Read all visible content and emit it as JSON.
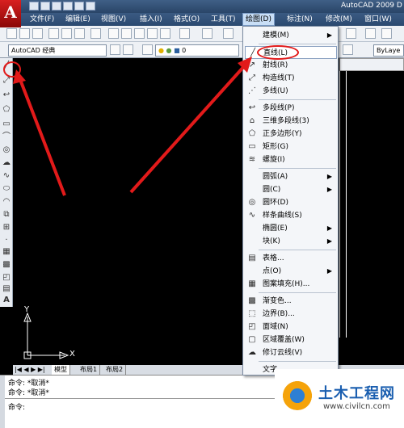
{
  "app": {
    "title": "AutoCAD 2009 D",
    "logo_letter": "A"
  },
  "menubar": {
    "items": [
      "文件(F)",
      "编辑(E)",
      "视图(V)",
      "插入(I)",
      "格式(O)",
      "工具(T)",
      "绘图(D)",
      "标注(N)",
      "修改(M)",
      "窗口(W)"
    ],
    "active_index": 6
  },
  "toolbar": {
    "workspace": "AutoCAD 经典",
    "layer_value": "0",
    "linetype_value": "ByLaye"
  },
  "draw_menu": {
    "items": [
      {
        "label": "建模(M)",
        "icon": "",
        "submenu": true
      },
      {
        "label": "直线(L)",
        "icon": "line-icon",
        "submenu": false,
        "highlighted": true
      },
      {
        "label": "射线(R)",
        "icon": "ray-icon",
        "submenu": false
      },
      {
        "label": "构造线(T)",
        "icon": "xline-icon",
        "submenu": false
      },
      {
        "label": "多线(U)",
        "icon": "mline-icon",
        "submenu": false
      },
      {
        "label": "多段线(P)",
        "icon": "pline-icon",
        "submenu": false
      },
      {
        "label": "三维多段线(3)",
        "icon": "3dpoly-icon",
        "submenu": false
      },
      {
        "label": "正多边形(Y)",
        "icon": "polygon-icon",
        "submenu": false
      },
      {
        "label": "矩形(G)",
        "icon": "rectangle-icon",
        "submenu": false
      },
      {
        "label": "螺旋(I)",
        "icon": "helix-icon",
        "submenu": false
      },
      {
        "label": "圆弧(A)",
        "icon": "",
        "submenu": true
      },
      {
        "label": "圆(C)",
        "icon": "",
        "submenu": true
      },
      {
        "label": "圆环(D)",
        "icon": "donut-icon",
        "submenu": false
      },
      {
        "label": "样条曲线(S)",
        "icon": "spline-icon",
        "submenu": false
      },
      {
        "label": "椭圆(E)",
        "icon": "",
        "submenu": true
      },
      {
        "label": "块(K)",
        "icon": "",
        "submenu": true
      },
      {
        "label": "表格...",
        "icon": "table-icon",
        "submenu": false
      },
      {
        "label": "点(O)",
        "icon": "",
        "submenu": true
      },
      {
        "label": "图案填充(H)...",
        "icon": "hatch-icon",
        "submenu": false
      },
      {
        "label": "渐变色...",
        "icon": "gradient-icon",
        "submenu": false
      },
      {
        "label": "边界(B)...",
        "icon": "boundary-icon",
        "submenu": false
      },
      {
        "label": "面域(N)",
        "icon": "region-icon",
        "submenu": false
      },
      {
        "label": "区域覆盖(W)",
        "icon": "wipeout-icon",
        "submenu": false
      },
      {
        "label": "修订云线(V)",
        "icon": "revcloud-icon",
        "submenu": false
      },
      {
        "label": "文字",
        "icon": "",
        "submenu": false
      }
    ]
  },
  "layout_tabs": [
    "模型",
    "布局1",
    "布局2"
  ],
  "ucs": {
    "x_label": "X",
    "y_label": "Y"
  },
  "command": {
    "history": [
      "命令: *取消*",
      "命令: *取消*"
    ],
    "prompt": "命令:"
  },
  "watermark": {
    "title": "土木工程网",
    "url": "www.civilcn.com"
  },
  "colors": {
    "annotation_red": "#e21a1a",
    "titlebar": "#2b4a70"
  }
}
